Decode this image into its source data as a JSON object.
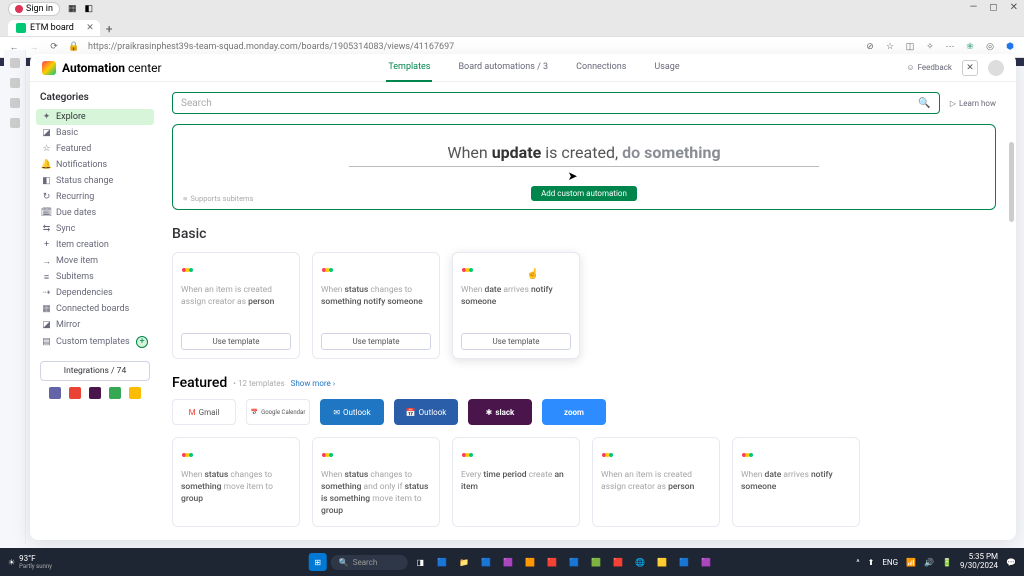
{
  "browser": {
    "signin": "Sign in",
    "tab_title": "ETM board",
    "url": "https://praikrasinphest39s-team-squad.monday.com/boards/1905314083/views/41167697",
    "pill": "ETM board"
  },
  "header": {
    "title_a": "Automation",
    "title_b": "center",
    "tabs": {
      "templates": "Templates",
      "board_automations": "Board automations / 3",
      "connections": "Connections",
      "usage": "Usage"
    },
    "feedback": "Feedback"
  },
  "sidebar": {
    "title": "Categories",
    "items": [
      {
        "label": "Explore"
      },
      {
        "label": "Basic"
      },
      {
        "label": "Featured"
      },
      {
        "label": "Notifications"
      },
      {
        "label": "Status change"
      },
      {
        "label": "Recurring"
      },
      {
        "label": "Due dates"
      },
      {
        "label": "Sync"
      },
      {
        "label": "Item creation"
      },
      {
        "label": "Move item"
      },
      {
        "label": "Subitems"
      },
      {
        "label": "Dependencies"
      },
      {
        "label": "Connected boards"
      },
      {
        "label": "Mirror"
      },
      {
        "label": "Custom templates"
      }
    ],
    "integrations": "Integrations / 74"
  },
  "search": {
    "placeholder": "Search",
    "learn": "Learn how"
  },
  "hero": {
    "when": "When ",
    "update": "update",
    "iscreated": " is created, ",
    "do": "do ",
    "something": "something",
    "button": "Add custom automation",
    "supports": "Supports subitems"
  },
  "basic": {
    "title": "Basic",
    "cards": [
      {
        "pre": "When an item is created assign creator as ",
        "b1": "person",
        "mid": "",
        "b2": "",
        "post": ""
      },
      {
        "pre": "When ",
        "b1": "status",
        "mid": " changes to ",
        "b2": "something notify someone",
        "post": ""
      },
      {
        "pre": "When ",
        "b1": "date",
        "mid": " arrives ",
        "b2": "notify someone",
        "post": ""
      }
    ],
    "use_template": "Use template"
  },
  "featured": {
    "title": "Featured",
    "count": "• 12 templates",
    "show_more": "Show more ›",
    "apps": {
      "gmail": "Gmail",
      "gcal": "Google Calendar",
      "outlook": "Outlook",
      "outlookcal": "Outlook",
      "slack": "slack",
      "zoom": "zoom"
    },
    "cards": [
      {
        "pre": "When ",
        "b1": "status",
        "mid": " changes to ",
        "b2": "something",
        "mid2": " move item to ",
        "b3": "group",
        "post": ""
      },
      {
        "pre": "When ",
        "b1": "status",
        "mid": " changes to ",
        "b2": "something",
        "mid2": " and only if ",
        "b3": "status is something",
        "mid3": " move item to ",
        "b4": "group"
      },
      {
        "pre": "Every ",
        "b1": "time period",
        "mid": " create ",
        "b2": "an item",
        "post": ""
      },
      {
        "pre": "When an item is created assign creator as ",
        "b1": "person",
        "mid": "",
        "b2": "",
        "post": ""
      },
      {
        "pre": "When ",
        "b1": "date",
        "mid": " arrives ",
        "b2": "notify someone",
        "post": ""
      }
    ]
  },
  "taskbar": {
    "temp": "93°F",
    "cond": "Partly sunny",
    "search": "Search",
    "lang": "ENG",
    "time": "5:35 PM",
    "date": "9/30/2024"
  }
}
